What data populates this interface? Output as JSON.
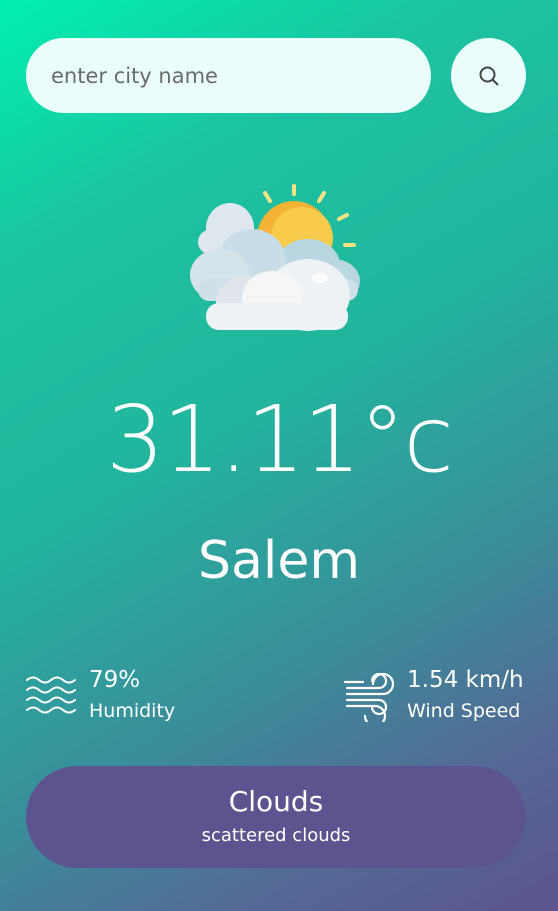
{
  "search": {
    "placeholder": "enter city name",
    "value": ""
  },
  "icons": {
    "search_button": "search-icon",
    "weather": "partly-cloudy-sun-icon",
    "humidity": "water-waves-icon",
    "wind": "wind-icon"
  },
  "weather": {
    "temperature": "31.11°c",
    "city": "Salem",
    "humidity_value": "79%",
    "humidity_label": "Humidity",
    "wind_value": "1.54 km/h",
    "wind_label": "Wind Speed",
    "condition": "Clouds",
    "description": "scattered clouds"
  },
  "colors": {
    "gradient_start": "#00f0b0",
    "gradient_end": "#5d5490",
    "input_bg": "#eafffb",
    "summary_bg": "#5c548e",
    "sun": "#f9c445",
    "cloud": "#eef2f5"
  }
}
